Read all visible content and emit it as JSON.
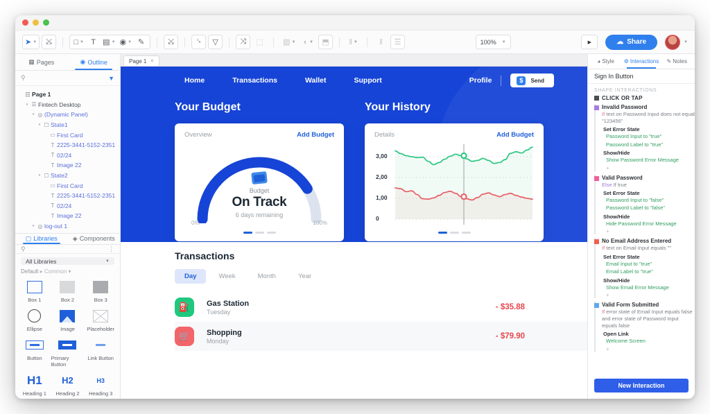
{
  "toolbar": {
    "left_tools": [
      {
        "name": "select-tool",
        "glyph": "➤",
        "caret": true,
        "boxed": true,
        "active": true
      },
      {
        "name": "connector-tool",
        "glyph": "⤡",
        "caret": false,
        "boxed": true,
        "active": false
      }
    ],
    "shape_tools": [
      {
        "name": "rectangle-tool",
        "glyph": "□",
        "caret": true
      },
      {
        "name": "text-tool",
        "glyph": "T",
        "caret": false
      },
      {
        "name": "input-tool",
        "glyph": "▤",
        "caret": true
      },
      {
        "name": "image-tool",
        "glyph": "◉",
        "caret": true
      },
      {
        "name": "pen-tool",
        "glyph": "✎",
        "caret": false
      }
    ],
    "mid_tools": [
      {
        "name": "resize-tool",
        "glyph": "⤡"
      },
      {
        "name": "align-tool",
        "glyph": "⤓"
      },
      {
        "name": "distribute-tool",
        "glyph": "▽"
      },
      {
        "name": "transform-tool",
        "glyph": "⤨"
      },
      {
        "name": "mask-tool",
        "glyph": "⬚",
        "dim": true
      }
    ],
    "right_tools": [
      {
        "name": "layout-tool",
        "glyph": "▧",
        "caret": true,
        "dim": true
      },
      {
        "name": "opacity-tool",
        "glyph": "◐",
        "caret": true,
        "dim": true
      },
      {
        "name": "order-tool",
        "glyph": "⬒",
        "caret": false,
        "dim": true
      },
      {
        "name": "align-left-tool",
        "glyph": "‖",
        "caret": true,
        "dim": true
      },
      {
        "name": "align-center-tool",
        "glyph": "‖",
        "caret": false,
        "dim": true
      },
      {
        "name": "distribute-v-tool",
        "glyph": "☰",
        "caret": false,
        "dim": true
      }
    ],
    "zoom_level": "100%",
    "preview_label": "▶",
    "share_label": "Share"
  },
  "left_panel": {
    "tabs": [
      {
        "label": "Pages",
        "icon": "pages-icon",
        "active": false
      },
      {
        "label": "Outline",
        "icon": "outline-icon",
        "active": true
      }
    ],
    "search_placeholder": "",
    "tree": [
      {
        "depth": 0,
        "label": "Page 1",
        "icon": "page-icon",
        "arrow": "",
        "style": "bold"
      },
      {
        "depth": 1,
        "label": "Fintech Desktop",
        "icon": "folder-icon",
        "arrow": "▾",
        "style": "normal"
      },
      {
        "depth": 2,
        "label": "(Dynamic Panel)",
        "icon": "panel-icon",
        "arrow": "▾",
        "style": "blue"
      },
      {
        "depth": 3,
        "label": "State1",
        "icon": "state-icon",
        "arrow": "▾",
        "style": "blue"
      },
      {
        "depth": 4,
        "label": "First Card",
        "icon": "shape-icon",
        "arrow": "",
        "style": "blue"
      },
      {
        "depth": 4,
        "label": "2225-3441-5152-2351",
        "icon": "text-icon",
        "arrow": "",
        "style": "blue"
      },
      {
        "depth": 4,
        "label": "02/24",
        "icon": "text-icon",
        "arrow": "",
        "style": "blue"
      },
      {
        "depth": 4,
        "label": "Image 22",
        "icon": "text-icon",
        "arrow": "",
        "style": "blue"
      },
      {
        "depth": 3,
        "label": "State2",
        "icon": "state-icon",
        "arrow": "▾",
        "style": "blue"
      },
      {
        "depth": 4,
        "label": "First Card",
        "icon": "shape-icon",
        "arrow": "",
        "style": "blue"
      },
      {
        "depth": 4,
        "label": "2225-3441-5152-2351",
        "icon": "text-icon",
        "arrow": "",
        "style": "blue"
      },
      {
        "depth": 4,
        "label": "02/24",
        "icon": "text-icon",
        "arrow": "",
        "style": "blue"
      },
      {
        "depth": 4,
        "label": "Image 22",
        "icon": "text-icon",
        "arrow": "",
        "style": "blue"
      },
      {
        "depth": 2,
        "label": "log-out 1",
        "icon": "panel-icon",
        "arrow": "▾",
        "style": "blue"
      }
    ],
    "library": {
      "tabs": [
        {
          "label": "Libraries",
          "icon": "bookmark-icon",
          "active": true
        },
        {
          "label": "Components",
          "icon": "components-icon",
          "active": false
        }
      ],
      "selected_library": "All Libraries",
      "breadcrumb_default": "Default",
      "breadcrumb_common": "Common",
      "items": [
        {
          "label": "Box 1",
          "thumb": "box-outline"
        },
        {
          "label": "Box 2",
          "thumb": "box-light"
        },
        {
          "label": "Box 3",
          "thumb": "box-dark"
        },
        {
          "label": "Ellipse",
          "thumb": "ellipse"
        },
        {
          "label": "Image",
          "thumb": "image"
        },
        {
          "label": "Placeholder",
          "thumb": "placeholder"
        },
        {
          "label": "Button",
          "thumb": "button"
        },
        {
          "label": "Primary Button",
          "thumb": "primary-button"
        },
        {
          "label": "Link Button",
          "thumb": "link-button"
        },
        {
          "label": "Heading 1",
          "thumb": "H1"
        },
        {
          "label": "Heading 2",
          "thumb": "H2"
        },
        {
          "label": "Heading 3",
          "thumb": "H3"
        }
      ]
    }
  },
  "canvas": {
    "page_tab": "Page 1",
    "design": {
      "nav": {
        "links": [
          "Home",
          "Transactions",
          "Wallet",
          "Support"
        ],
        "profile": "Profile",
        "send_button": "Send"
      },
      "budget": {
        "heading": "Your Budget",
        "card_title": "Overview",
        "card_action": "Add Budget",
        "gauge_label": "Budget",
        "gauge_value": "On Track",
        "gauge_sub": "6 days remaining",
        "scale_min": "0%",
        "scale_max": "100%",
        "gauge_percent": 82
      },
      "history": {
        "heading": "Your History",
        "card_title": "Details",
        "card_action": "Add Budget",
        "y_ticks": [
          "3,00",
          "2,00",
          "1,00",
          "0"
        ]
      },
      "transactions": {
        "title": "Transactions",
        "tabs": [
          {
            "label": "Day",
            "active": true
          },
          {
            "label": "Week",
            "active": false
          },
          {
            "label": "Month",
            "active": false
          },
          {
            "label": "Year",
            "active": false
          }
        ],
        "rows": [
          {
            "name": "Gas Station",
            "day": "Tuesday",
            "amount": "- $35.88",
            "icon": "fuel-icon",
            "color": "green"
          },
          {
            "name": "Shopping",
            "day": "Monday",
            "amount": "- $79.90",
            "icon": "cart-icon",
            "color": "red"
          }
        ]
      }
    }
  },
  "chart_data": {
    "type": "line",
    "title": "Details",
    "xlabel": "",
    "ylabel": "",
    "ylim": [
      0,
      3.6
    ],
    "y_ticks": [
      3.0,
      2.0,
      1.0,
      0
    ],
    "y_tick_labels": [
      "3,00",
      "2,00",
      "1,00",
      "0"
    ],
    "grid": true,
    "legend": "none",
    "cursor_x_fraction": 0.5,
    "series": [
      {
        "name": "green-series",
        "color": "#34c986",
        "values": [
          3.28,
          3.15,
          3.05,
          3.0,
          2.96,
          2.98,
          2.78,
          2.62,
          2.72,
          2.88,
          3.02,
          3.12,
          3.05,
          2.9,
          2.78,
          2.82,
          2.92,
          2.82,
          2.68,
          2.72,
          2.86,
          3.16,
          3.24,
          3.18,
          3.32,
          3.46
        ],
        "marker_index": 12,
        "marker_value": 3.05
      },
      {
        "name": "red-series",
        "color": "#e8646a",
        "values": [
          1.5,
          1.46,
          1.32,
          1.36,
          1.18,
          0.98,
          0.96,
          1.02,
          1.14,
          1.28,
          1.34,
          1.24,
          1.08,
          0.98,
          0.92,
          1.04,
          1.2,
          1.26,
          1.16,
          1.08,
          1.18,
          1.24,
          1.14,
          1.06,
          1.0,
          0.96
        ],
        "marker_index": 12,
        "marker_value": 1.08
      }
    ]
  },
  "right_panel": {
    "tabs": [
      {
        "label": "Style",
        "icon": "style-icon",
        "active": false
      },
      {
        "label": "Interactions",
        "icon": "interactions-icon",
        "active": true
      },
      {
        "label": "Notes",
        "icon": "notes-icon",
        "active": false
      }
    ],
    "selection": "Sign In Button",
    "section_label": "SHAPE INTERACTIONS",
    "event": "CLICK OR TAP",
    "cases": [
      {
        "name": "Invalid Password",
        "swatch": "#a77ce0",
        "condition_prefix": "If",
        "condition": "text on Password Input does not equal \"123456\"",
        "actions": [
          {
            "label": "Set Error State",
            "targets": [
              "Password Input to \"true\"",
              "Password Label to \"true\""
            ]
          },
          {
            "label": "Show/Hide",
            "targets": [
              "Show Password Error Message"
            ]
          }
        ]
      },
      {
        "name": "Valid Password",
        "swatch": "#ef5fa0",
        "condition_prefix": "Else",
        "condition": "If true",
        "actions": [
          {
            "label": "Set Error State",
            "targets": [
              "Password Input to \"false\"",
              "Password Label to \"false\""
            ]
          },
          {
            "label": "Show/Hide",
            "targets": [
              "Hide Password Error Message"
            ]
          }
        ]
      },
      {
        "name": "No Email Address Entered",
        "swatch": "#f0604a",
        "condition_prefix": "If",
        "condition": "text on Email Input equals \"\"",
        "actions": [
          {
            "label": "Set Error State",
            "targets": [
              "Email Input to \"true\"",
              "Email Label to \"true\""
            ]
          },
          {
            "label": "Show/Hide",
            "targets": [
              "Show Email Error Message"
            ]
          }
        ]
      },
      {
        "name": "Valid Form Submitted",
        "swatch": "#5fa8e8",
        "condition_prefix": "If",
        "condition": "error state of Email Input equals false and error state of Password Input equals false",
        "actions": [
          {
            "label": "Open Link",
            "targets": [
              "Welcome Screen"
            ]
          }
        ]
      }
    ],
    "new_interaction_label": "New Interaction"
  }
}
